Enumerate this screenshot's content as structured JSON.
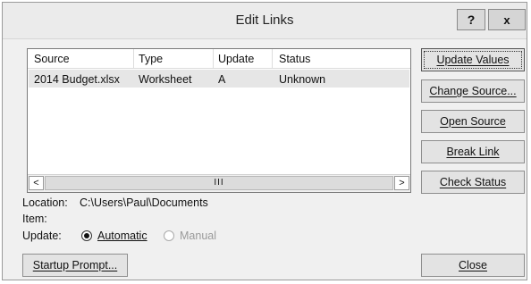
{
  "window": {
    "title": "Edit Links",
    "help_label": "?",
    "close_label": "x"
  },
  "list": {
    "columns": [
      "Source",
      "Type",
      "Update",
      "Status"
    ],
    "rows": [
      {
        "source": "2014 Budget.xlsx",
        "type": "Worksheet",
        "update": "A",
        "status": "Unknown"
      }
    ],
    "scroll_left": "<",
    "scroll_right": ">",
    "thumb_grip": "III"
  },
  "buttons": {
    "update_values": "Update Values",
    "change_source": "Change Source...",
    "open_source": "Open Source",
    "break_link": "Break Link",
    "check_status": "Check Status",
    "startup_prompt": "Startup Prompt...",
    "close": "Close"
  },
  "info": {
    "location_label": "Location:",
    "location_value": "C:\\Users\\Paul\\Documents",
    "item_label": "Item:",
    "item_value": "",
    "update_label": "Update:",
    "automatic": "Automatic",
    "manual": "Manual",
    "selected_mode": "Automatic"
  }
}
